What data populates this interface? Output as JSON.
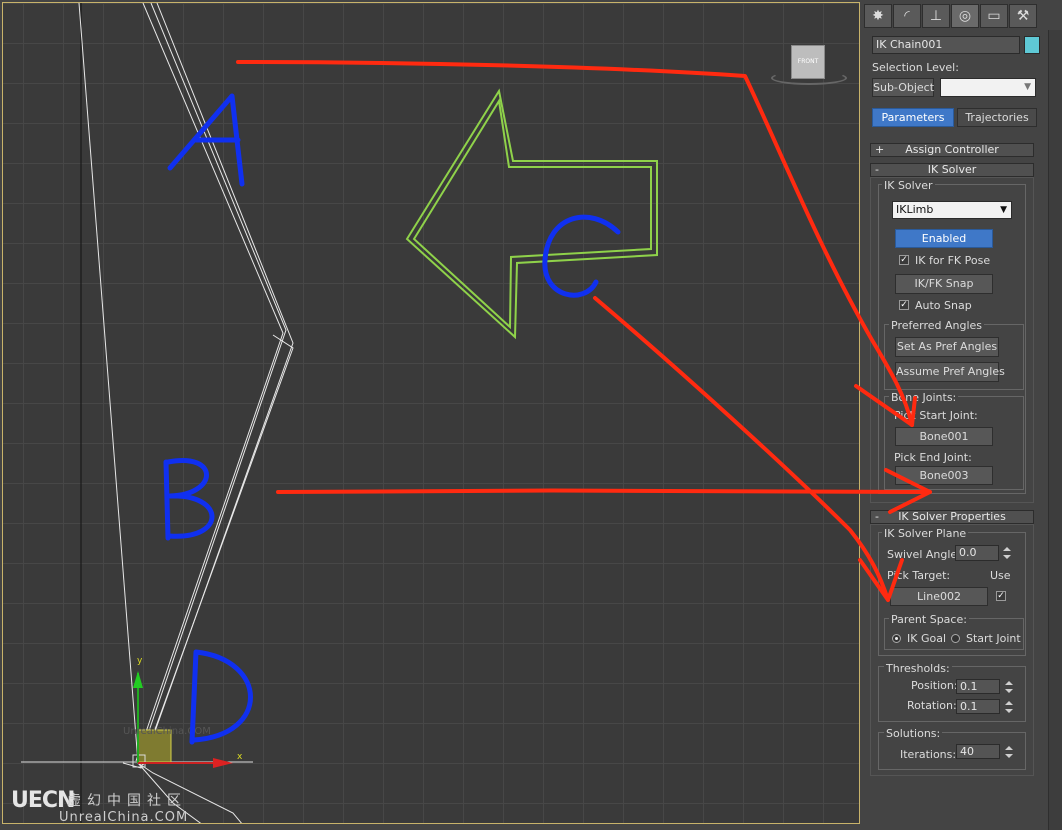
{
  "viewport": {
    "viewcube_label": "FRONT",
    "axis_x": "x",
    "axis_y": "y",
    "faint_text": "UnrealChina.COM"
  },
  "watermark": {
    "logo": "UECN",
    "cn": "虚幻中国社区",
    "en": "UnrealChina.COM"
  },
  "annotations": {
    "a": "A",
    "b": "B",
    "c": "C",
    "d": "D"
  },
  "panel": {
    "tabs": [
      "create-icon",
      "modify-icon",
      "hierarchy-icon",
      "motion-icon",
      "display-icon",
      "utilities-icon"
    ],
    "object_name": "IK Chain001",
    "object_color": "#5fc9d6",
    "selection_level_label": "Selection Level:",
    "sub_object_button": "Sub-Object",
    "sub_object_value": "",
    "parameters_tab": "Parameters",
    "trajectories_tab": "Trajectories",
    "assign_controller": {
      "sign": "+",
      "title": "Assign Controller"
    },
    "ik_solver_rollout": {
      "sign": "-",
      "title": "IK Solver"
    },
    "ik_solver": {
      "group_label": "IK Solver",
      "solver_select": "IKLimb",
      "enabled_button": "Enabled",
      "ik_for_fk_pose": "IK for FK Pose",
      "ik_fk_snap": "IK/FK Snap",
      "auto_snap": "Auto Snap",
      "preferred_angles_label": "Preferred Angles",
      "set_as_pref": "Set As Pref Angles",
      "assume_pref": "Assume Pref Angles",
      "bone_joints_label": "Bone Joints:",
      "start_joint_label": "Pick Start Joint:",
      "start_joint_button": "Bone001",
      "end_joint_label": "Pick End Joint:",
      "end_joint_button": "Bone003"
    },
    "ik_solver_properties_rollout": {
      "sign": "-",
      "title": "IK Solver Properties"
    },
    "ik_solver_plane": {
      "group_label": "IK Solver Plane",
      "swivel_label": "Swivel Angle:",
      "swivel_value": "0.0",
      "pick_target_label": "Pick Target:",
      "use_label": "Use",
      "target_button": "Line002",
      "parent_space_label": "Parent Space:",
      "ik_goal": "IK Goal",
      "start_joint": "Start Joint"
    },
    "thresholds": {
      "group_label": "Thresholds:",
      "position_label": "Position:",
      "position_value": "0.1",
      "rotation_label": "Rotation:",
      "rotation_value": "0.1"
    },
    "solutions": {
      "group_label": "Solutions:",
      "iterations_label": "Iterations:",
      "iterations_value": "40"
    }
  },
  "colors": {
    "annotation_red": "#ff2a10",
    "annotation_blue": "#1030f0",
    "arrow_green": "#8fd24a",
    "highlight_blue": "#3f78c8"
  }
}
